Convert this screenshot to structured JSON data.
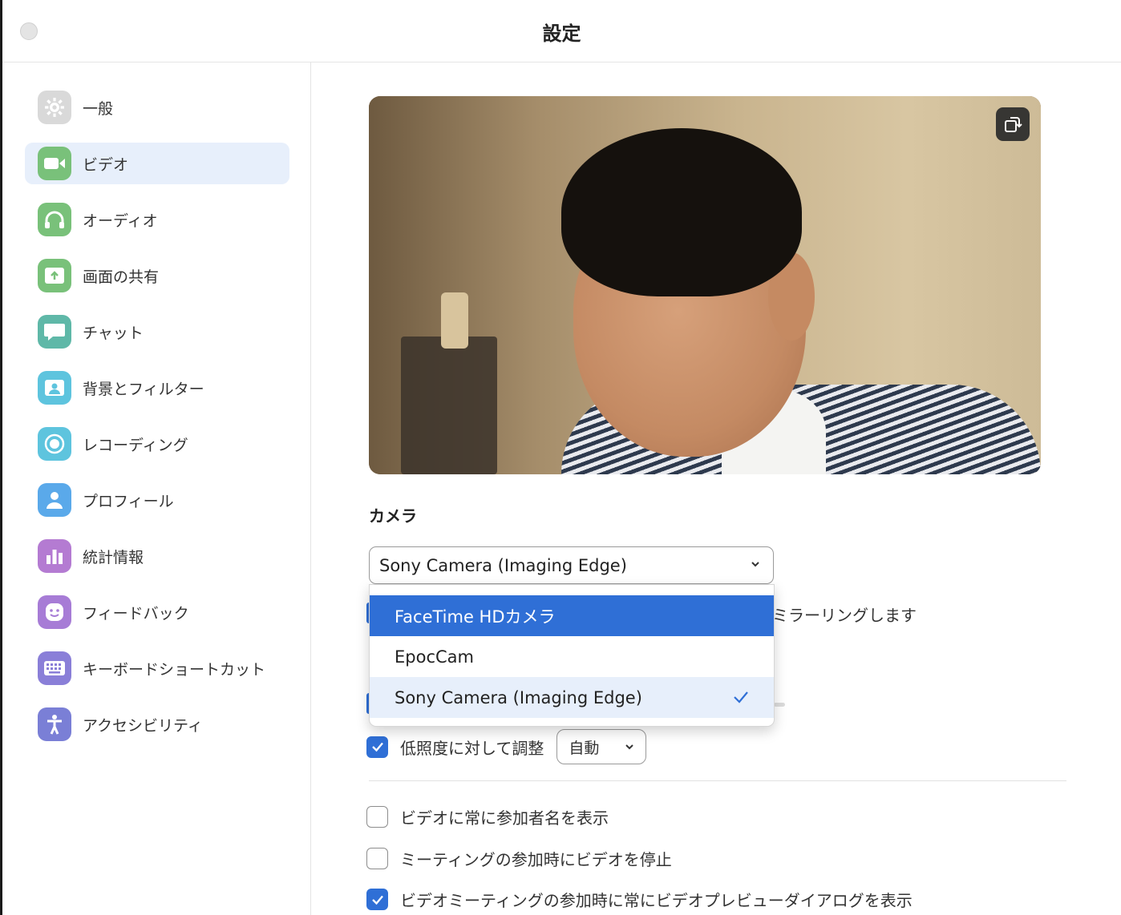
{
  "window": {
    "title": "設定"
  },
  "sidebar": {
    "items": [
      {
        "label": "一般",
        "icon": "gear-icon",
        "color": "#d9d9d9"
      },
      {
        "label": "ビデオ",
        "icon": "video-camera-icon",
        "color": "#79c17a",
        "active": true
      },
      {
        "label": "オーディオ",
        "icon": "headphones-icon",
        "color": "#79c17a"
      },
      {
        "label": "画面の共有",
        "icon": "share-screen-icon",
        "color": "#79c17a"
      },
      {
        "label": "チャット",
        "icon": "chat-bubble-icon",
        "color": "#5fb8a8"
      },
      {
        "label": "背景とフィルター",
        "icon": "portrait-icon",
        "color": "#5ec4de"
      },
      {
        "label": "レコーディング",
        "icon": "record-icon",
        "color": "#5ec4de"
      },
      {
        "label": "プロフィール",
        "icon": "person-icon",
        "color": "#5aa9ea"
      },
      {
        "label": "統計情報",
        "icon": "bar-chart-icon",
        "color": "#b47bd2"
      },
      {
        "label": "フィードバック",
        "icon": "smiley-icon",
        "color": "#a77cd6"
      },
      {
        "label": "キーボードショートカット",
        "icon": "keyboard-icon",
        "color": "#8a7fd8"
      },
      {
        "label": "アクセシビリティ",
        "icon": "accessibility-icon",
        "color": "#7a7fd6"
      }
    ]
  },
  "video": {
    "camera_section_title": "カメラ",
    "camera_select": {
      "value": "Sony Camera (Imaging Edge)",
      "options": [
        "FaceTime HDカメラ",
        "EpocCam",
        "Sony Camera (Imaging Edge)"
      ],
      "hovered_index": 0,
      "selected_index": 2
    },
    "mirror_label_partial": "ミラーリングします",
    "low_light": {
      "label": "低照度に対して調整",
      "checked": true,
      "mode_value": "自動"
    },
    "options": [
      {
        "label": "ビデオに常に参加者名を表示",
        "checked": false
      },
      {
        "label": "ミーティングの参加時にビデオを停止",
        "checked": false
      },
      {
        "label": "ビデオミーティングの参加時に常にビデオプレビューダイアログを表示",
        "checked": true
      }
    ]
  },
  "colors": {
    "accent": "#2f6fd6",
    "active_bg": "#e7effb"
  }
}
